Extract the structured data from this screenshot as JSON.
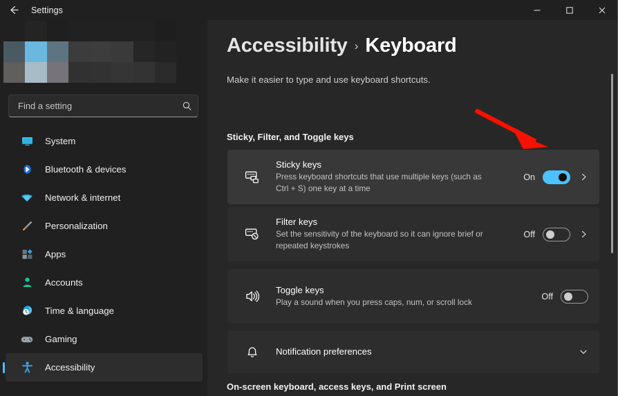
{
  "window": {
    "app_title": "Settings",
    "back_icon": "arrow-left-icon",
    "controls": [
      {
        "name": "minimize",
        "glyph": "minimize-icon"
      },
      {
        "name": "maximize",
        "glyph": "maximize-icon"
      },
      {
        "name": "close",
        "glyph": "close-icon"
      }
    ]
  },
  "sidebar": {
    "profile": {
      "blurred": true,
      "icon": "blurred-account-avatar"
    },
    "search": {
      "placeholder": "Find a setting",
      "value": "",
      "icon": "search-icon"
    },
    "items": [
      {
        "label": "System",
        "icon": "monitor-icon",
        "active": false
      },
      {
        "label": "Bluetooth & devices",
        "icon": "bluetooth-icon",
        "active": false
      },
      {
        "label": "Network & internet",
        "icon": "wifi-icon",
        "active": false
      },
      {
        "label": "Personalization",
        "icon": "paintbrush-icon",
        "active": false
      },
      {
        "label": "Apps",
        "icon": "apps-icon",
        "active": false
      },
      {
        "label": "Accounts",
        "icon": "person-icon",
        "active": false
      },
      {
        "label": "Time & language",
        "icon": "clock-globe-icon",
        "active": false
      },
      {
        "label": "Gaming",
        "icon": "gamepad-icon",
        "active": false
      },
      {
        "label": "Accessibility",
        "icon": "accessibility-person-icon",
        "active": true
      }
    ]
  },
  "main": {
    "breadcrumb": {
      "parent": "Accessibility",
      "separator": "›",
      "current": "Keyboard"
    },
    "subtitle": "Make it easier to type and use keyboard shortcuts.",
    "sections": [
      {
        "heading": "Sticky, Filter, and Toggle keys"
      },
      {
        "heading": "On-screen keyboard, access keys, and Print screen"
      }
    ],
    "cards": [
      {
        "title": "Sticky keys",
        "desc": "Press keyboard shortcuts that use multiple keys (such as Ctrl + S) one key at a time",
        "icon": "sticky-keys-icon",
        "state_label": "On",
        "toggle_on": true,
        "has_chevron": true,
        "hovered": true
      },
      {
        "title": "Filter keys",
        "desc": "Set the sensitivity of the keyboard so it can ignore brief or repeated keystrokes",
        "icon": "filter-keys-icon",
        "state_label": "Off",
        "toggle_on": false,
        "has_chevron": true,
        "hovered": false
      },
      {
        "title": "Toggle keys",
        "desc": "Play a sound when you press caps, num, or scroll lock",
        "icon": "speaker-icon",
        "state_label": "Off",
        "toggle_on": false,
        "has_chevron": false,
        "hovered": false
      }
    ],
    "expander": {
      "title": "Notification preferences",
      "icon": "bell-icon",
      "chevron": "chevron-down-icon"
    }
  },
  "annotation": {
    "type": "arrow",
    "color": "#f81000",
    "points_at": "sticky-keys-toggle"
  },
  "colors": {
    "accent": "#4cc2ff",
    "window_bg": "#202020",
    "panel_bg": "#272727",
    "card_bg": "#2d2d2d",
    "card_hover_bg": "#383838",
    "annotation_red": "#f81000"
  }
}
